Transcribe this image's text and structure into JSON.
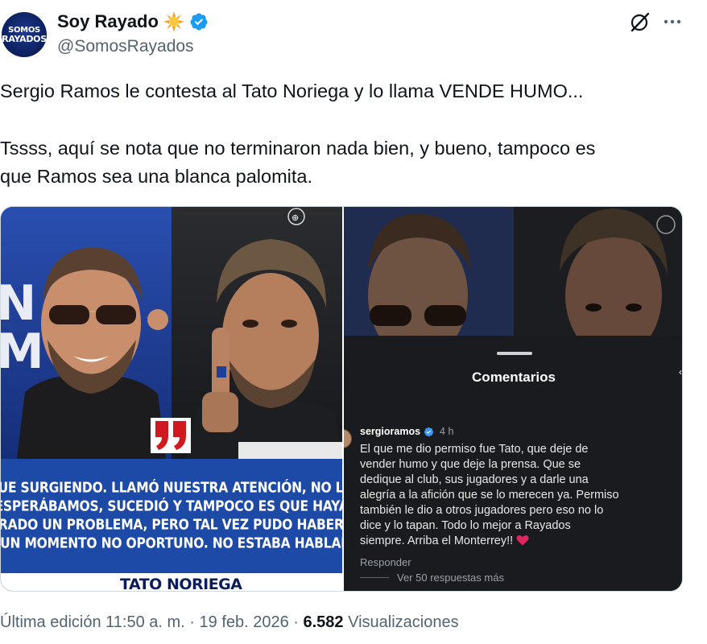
{
  "author": {
    "display_name": "Soy Rayado",
    "handle": "@SomosRayados",
    "avatar_text_line1": "SOMOS",
    "avatar_text_line2": "RAYADOS"
  },
  "icons": {
    "emoji": "sun-emoji",
    "verified": "verified-badge-icon",
    "grok": "grok-icon",
    "more": "more-options-icon"
  },
  "tweet": {
    "paragraph1": "Sergio Ramos le contesta al Tato Noriega y lo llama VENDE HUMO...",
    "paragraph2_line1": "Tssss, aquí se nota que no terminaron nada bien, y bueno, tampoco es",
    "paragraph2_line2": "que Ramos sea una blanca palomita."
  },
  "media_left": {
    "quote_lines": [
      "FUE SURGIENDO. LLAMÓ NUESTRA ATENCIÓN, NO LO",
      "ESPERÁBAMOS, SUCEDIÓ Y TAMPOCO ES QUE HAYA",
      "GENERADO UN PROBLEMA, PERO TAL VEZ PUDO HABER SIDO",
      "EN UN MOMENTO NO OPORTUNO. NO ESTABA HABLADO."
    ],
    "attribution": "TATO NORIEGA"
  },
  "media_right": {
    "panel_title": "Comentarios",
    "comment": {
      "username": "sergioramos",
      "time": "4 h",
      "lines": [
        "El que me dio permiso fue Tato, que deje de",
        "vender humo y que deje la prensa.  Que se",
        "dedique al club, sus jugadores y a darle una",
        "alegría a la afición que se lo merecen ya.  Permiso",
        "también le dio a otros jugadores pero eso no lo",
        "dice y lo tapan.  Todo lo mejor a Rayados",
        "siempre. Arriba el Monterrey!!"
      ],
      "reply_label": "Responder",
      "view_replies_label": "Ver 50 respuestas más"
    }
  },
  "footer": {
    "edited": "Última edición 11:50 a. m. · 19 feb. 2026 · ",
    "views_count": "6.582",
    "views_label": " Visualizaciones"
  }
}
